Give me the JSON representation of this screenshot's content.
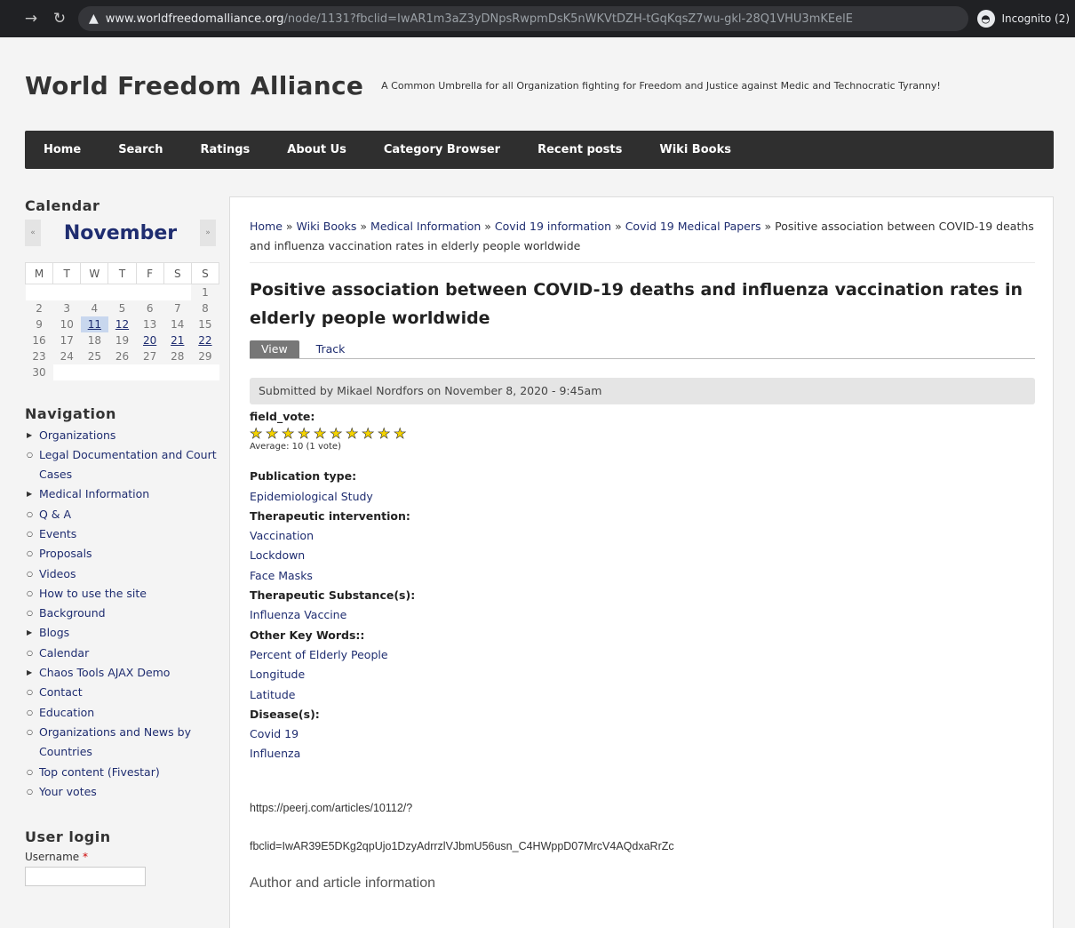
{
  "browser": {
    "url_host": "www.worldfreedomalliance.org",
    "url_path": "/node/1131?fbclid=IwAR1m3aZ3yDNpsRwpmDsK5nWKVtDZH-tGqKqsZ7wu-gkl-28Q1VHU3mKEelE",
    "incognito_label": "Incognito (2)"
  },
  "site": {
    "title": "World Freedom Alliance",
    "slogan": "A Common Umbrella for all Organization fighting for Freedom and Justice against Medic and Technocratic Tyranny!"
  },
  "main_nav": [
    "Home",
    "Search",
    "Ratings",
    "About Us",
    "Category Browser",
    "Recent posts",
    "Wiki Books"
  ],
  "calendar": {
    "title": "Calendar",
    "month": "November",
    "prev": "«",
    "next": "»",
    "weekdays": [
      "M",
      "T",
      "W",
      "T",
      "F",
      "S",
      "S"
    ]
  },
  "navigation": {
    "title": "Navigation",
    "items": [
      {
        "label": "Organizations",
        "expandable": true
      },
      {
        "label": "Legal Documentation and Court Cases",
        "expandable": false
      },
      {
        "label": "Medical Information",
        "expandable": true
      },
      {
        "label": "Q & A",
        "expandable": false
      },
      {
        "label": "Events",
        "expandable": false
      },
      {
        "label": "Proposals",
        "expandable": false
      },
      {
        "label": "Videos",
        "expandable": false
      },
      {
        "label": "How to use the site",
        "expandable": false
      },
      {
        "label": "Background",
        "expandable": false
      },
      {
        "label": "Blogs",
        "expandable": true
      },
      {
        "label": "Calendar",
        "expandable": false
      },
      {
        "label": "Chaos Tools AJAX Demo",
        "expandable": true
      },
      {
        "label": "Contact",
        "expandable": false
      },
      {
        "label": "Education",
        "expandable": false
      },
      {
        "label": "Organizations and News by Countries",
        "expandable": false
      },
      {
        "label": "Top content (Fivestar)",
        "expandable": false
      },
      {
        "label": "Your votes",
        "expandable": false
      }
    ]
  },
  "user_login": {
    "title": "User login",
    "username_label": "Username",
    "required_mark": "*"
  },
  "breadcrumb": {
    "items": [
      "Home",
      "Wiki Books",
      "Medical Information",
      "Covid 19 information",
      "Covid 19 Medical Papers"
    ],
    "separator": "»",
    "current": "Positive association between COVID-19 deaths and influenza vaccination rates in elderly people worldwide"
  },
  "article": {
    "title": "Positive association between COVID-19 deaths and influenza vaccination rates in elderly people worldwide",
    "tabs": {
      "view": "View",
      "track": "Track"
    },
    "submitted": "Submitted by Mikael Nordfors on November 8, 2020 - 9:45am",
    "vote_label": "field_vote:",
    "rating": {
      "value": 10,
      "max": 10
    },
    "vote_average": "Average: 10 (1 vote)",
    "fields": [
      {
        "label": "Publication type:",
        "values": [
          "Epidemiological Study"
        ]
      },
      {
        "label": "Therapeutic intervention:",
        "values": [
          "Vaccination",
          "Lockdown",
          "Face Masks"
        ]
      },
      {
        "label": "Therapeutic Substance(s):",
        "values": [
          "Influenza Vaccine"
        ]
      },
      {
        "label": "Other Key Words::",
        "values": [
          "Percent of Elderly People",
          "Longitude",
          "Latitude"
        ]
      },
      {
        "label": "Disease(s):",
        "values": [
          "Covid 19",
          "Influenza"
        ]
      }
    ],
    "body_url_line1": "https://peerj.com/articles/10112/?",
    "body_url_line2": "fbclid=IwAR39E5DKg2qpUjo1DzyAdrrzlVJbmU56usn_C4HWppD07MrcV4AQdxaRrZc",
    "body_heading": "Author and article information"
  }
}
